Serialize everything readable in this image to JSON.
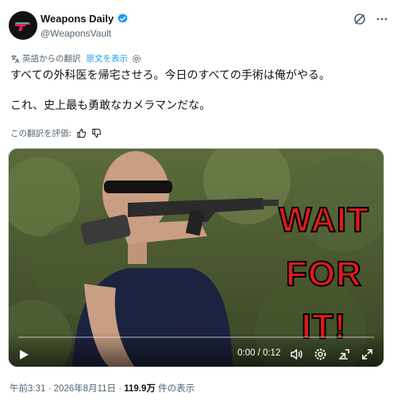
{
  "author": {
    "display_name": "Weapons Daily",
    "handle": "@WeaponsVault",
    "verified_color": "#1d9bf0"
  },
  "translation": {
    "note": "英語からの翻訳",
    "show_original": "原文を表示"
  },
  "tweet": {
    "line1": "すべての外科医を帰宅させろ。今日のすべての手術は俺がやる。",
    "line2": "これ、史上最も勇敢なカメラマンだな。"
  },
  "rating": {
    "label": "この翻訳を評価:"
  },
  "video": {
    "overlay_lines": [
      "WAIT",
      "FOR",
      "IT!"
    ],
    "time": "0:00 / 0:12",
    "progress": 0
  },
  "meta": {
    "timestamp": "午前3:31 · 2026年8月11日 · ",
    "views": "119.9万",
    "views_suffix": " 件の表示"
  },
  "icons": [
    "grok-icon",
    "more-icon",
    "translate-icon",
    "gear-icon",
    "thumbs-up-icon",
    "thumbs-down-icon",
    "play-icon",
    "volume-icon",
    "settings-icon",
    "minimize-icon",
    "fullscreen-icon"
  ]
}
